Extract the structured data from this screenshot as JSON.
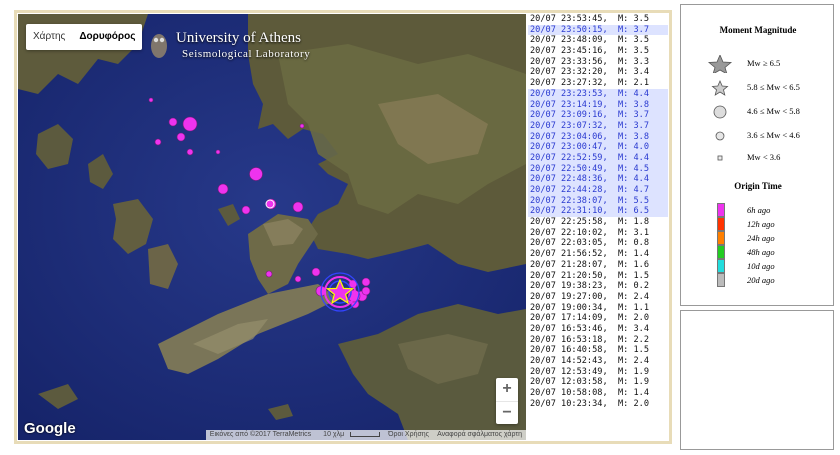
{
  "map": {
    "toggle": {
      "map_label": "Χάρτης",
      "satellite_label": "Δορυφόρος"
    },
    "logo": {
      "line1": "University of Athens",
      "line2": "Seismological Laboratory"
    },
    "zoom": {
      "in": "+",
      "out": "−"
    },
    "google_label": "Google",
    "attribution": {
      "imagery": "Εικόνες από ©2017 TerraMetrics",
      "scale": "10 χλμ",
      "terms": "Όροι Χρήσης",
      "report": "Αναφορά σφάλματος χάρτη"
    },
    "colors": {
      "magenta": "#ee33ee",
      "ring_blue": "#3344ff",
      "star": "#ee33ee"
    }
  },
  "events": [
    {
      "time": "20/07 23:53:45",
      "mag": "3.5",
      "highlight": false
    },
    {
      "time": "20/07 23:50:15",
      "mag": "3.7",
      "highlight": true
    },
    {
      "time": "20/07 23:48:09",
      "mag": "3.5",
      "highlight": false
    },
    {
      "time": "20/07 23:45:16",
      "mag": "3.5",
      "highlight": false
    },
    {
      "time": "20/07 23:33:56",
      "mag": "3.3",
      "highlight": false
    },
    {
      "time": "20/07 23:32:20",
      "mag": "3.4",
      "highlight": false
    },
    {
      "time": "20/07 23:27:32",
      "mag": "2.1",
      "highlight": false
    },
    {
      "time": "20/07 23:23:53",
      "mag": "4.4",
      "highlight": true
    },
    {
      "time": "20/07 23:14:19",
      "mag": "3.8",
      "highlight": true
    },
    {
      "time": "20/07 23:09:16",
      "mag": "3.7",
      "highlight": true
    },
    {
      "time": "20/07 23:07:32",
      "mag": "3.7",
      "highlight": true
    },
    {
      "time": "20/07 23:04:06",
      "mag": "3.8",
      "highlight": true
    },
    {
      "time": "20/07 23:00:47",
      "mag": "4.0",
      "highlight": true
    },
    {
      "time": "20/07 22:52:59",
      "mag": "4.4",
      "highlight": true
    },
    {
      "time": "20/07 22:50:49",
      "mag": "4.5",
      "highlight": true
    },
    {
      "time": "20/07 22:48:36",
      "mag": "4.4",
      "highlight": true
    },
    {
      "time": "20/07 22:44:28",
      "mag": "4.7",
      "highlight": true
    },
    {
      "time": "20/07 22:38:07",
      "mag": "5.5",
      "highlight": true
    },
    {
      "time": "20/07 22:31:10",
      "mag": "6.5",
      "highlight": true
    },
    {
      "time": "20/07 22:25:58",
      "mag": "1.8",
      "highlight": false
    },
    {
      "time": "20/07 22:10:02",
      "mag": "3.1",
      "highlight": false
    },
    {
      "time": "20/07 22:03:05",
      "mag": "0.8",
      "highlight": false
    },
    {
      "time": "20/07 21:56:52",
      "mag": "1.4",
      "highlight": false
    },
    {
      "time": "20/07 21:28:07",
      "mag": "1.6",
      "highlight": false
    },
    {
      "time": "20/07 21:20:50",
      "mag": "1.5",
      "highlight": false
    },
    {
      "time": "20/07 19:38:23",
      "mag": "0.2",
      "highlight": false
    },
    {
      "time": "20/07 19:27:00",
      "mag": "2.4",
      "highlight": false
    },
    {
      "time": "20/07 19:00:34",
      "mag": "1.1",
      "highlight": false
    },
    {
      "time": "20/07 17:14:09",
      "mag": "2.0",
      "highlight": false
    },
    {
      "time": "20/07 16:53:46",
      "mag": "3.4",
      "highlight": false
    },
    {
      "time": "20/07 16:53:18",
      "mag": "2.2",
      "highlight": false
    },
    {
      "time": "20/07 16:40:58",
      "mag": "1.5",
      "highlight": false
    },
    {
      "time": "20/07 14:52:43",
      "mag": "2.4",
      "highlight": false
    },
    {
      "time": "20/07 12:53:49",
      "mag": "1.9",
      "highlight": false
    },
    {
      "time": "20/07 12:03:58",
      "mag": "1.9",
      "highlight": false
    },
    {
      "time": "20/07 10:58:08",
      "mag": "1.4",
      "highlight": false
    },
    {
      "time": "20/07 10:23:34",
      "mag": "2.0",
      "highlight": false
    }
  ],
  "legend": {
    "magnitude_title": "Moment Magnitude",
    "magnitude_rows": [
      {
        "sym": "star-large",
        "label": "Mw ≥ 6.5"
      },
      {
        "sym": "star-small",
        "label": "5.8 ≤ Mw < 6.5"
      },
      {
        "sym": "circle-large",
        "label": "4.6 ≤ Mw < 5.8"
      },
      {
        "sym": "circle-medium",
        "label": "3.6 ≤ Mw < 4.6"
      },
      {
        "sym": "square-small",
        "label": "Mw < 3.6"
      }
    ],
    "origin_title": "Origin Time",
    "origin_rows": [
      {
        "color": "#ee33ee",
        "label": "6h ago"
      },
      {
        "color": "#ff3300",
        "label": "12h ago"
      },
      {
        "color": "#ff7f00",
        "label": "24h ago"
      },
      {
        "color": "#22cc22",
        "label": "48h ago"
      },
      {
        "color": "#22dddd",
        "label": "10d ago"
      },
      {
        "color": "#bbbbbb",
        "label": "20d ago"
      }
    ]
  }
}
